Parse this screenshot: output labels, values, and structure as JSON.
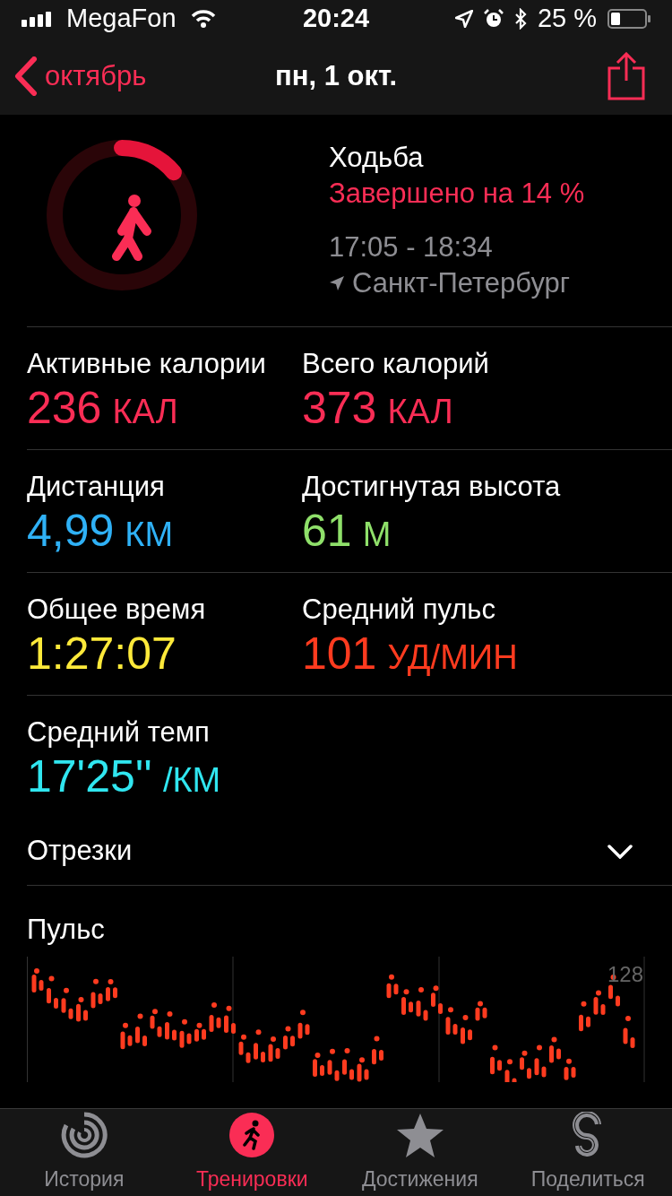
{
  "status_bar": {
    "carrier": "MegaFon",
    "time": "20:24",
    "battery": "25 %"
  },
  "nav": {
    "back": "октябрь",
    "title": "пн, 1 окт."
  },
  "workout": {
    "name": "Ходьба",
    "progress_text": "Завершено на 14 %",
    "time_range": "17:05 - 18:34",
    "location": "Санкт-Петербург"
  },
  "stats": [
    [
      {
        "label": "Активные калории",
        "value": "236",
        "unit": "КАЛ",
        "color": "#fa2d55"
      },
      {
        "label": "Всего калорий",
        "value": "373",
        "unit": "КАЛ",
        "color": "#fa2d55"
      }
    ],
    [
      {
        "label": "Дистанция",
        "value": "4,99",
        "unit": "КМ",
        "color": "#2fb1f6"
      },
      {
        "label": "Достигнутая высота",
        "value": "61",
        "unit": "М",
        "color": "#8fe06a"
      }
    ],
    [
      {
        "label": "Общее время",
        "value": "1:27:07",
        "color": "#fde93a"
      },
      {
        "label": "Средний пульс",
        "value": "101",
        "unit": "УД/МИН",
        "color": "#ff3b1f"
      }
    ],
    [
      {
        "label": "Средний темп",
        "value": "17'25''",
        "unit": "/КМ",
        "color": "#30e6f0"
      }
    ]
  ],
  "splits": {
    "label": "Отрезки",
    "expanded": false
  },
  "pulse": {
    "title": "Пульс",
    "max_label": "128"
  },
  "tabs": [
    {
      "label": "История",
      "selected": false
    },
    {
      "label": "Тренировки",
      "selected": true
    },
    {
      "label": "Достижения",
      "selected": false
    },
    {
      "label": "Поделиться",
      "selected": false
    }
  ]
}
